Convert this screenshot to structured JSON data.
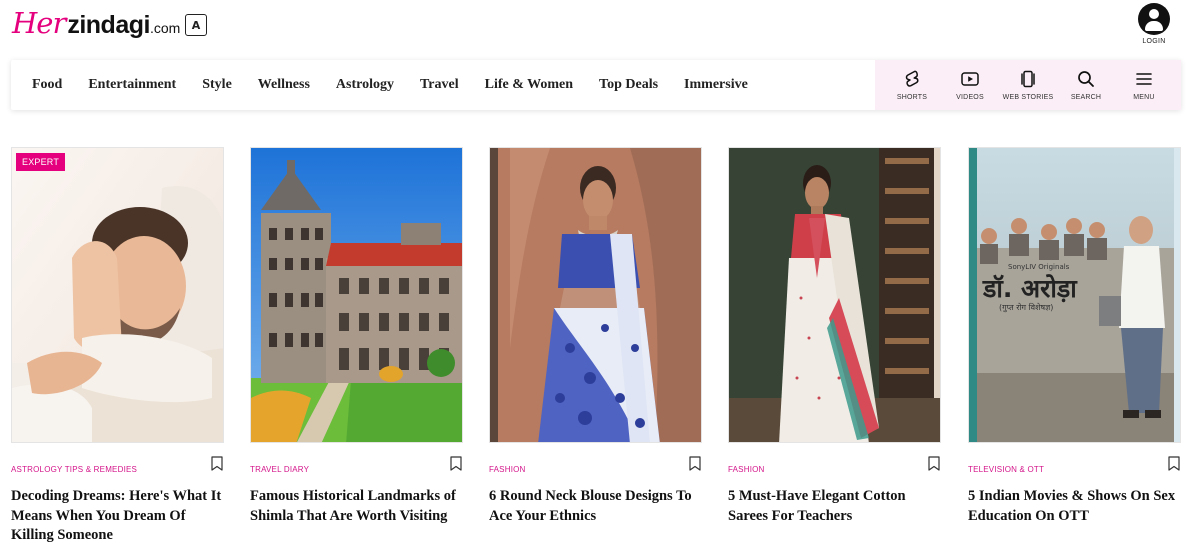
{
  "brand": {
    "logo_her": "Her",
    "logo_zindagi": "zindagi",
    "logo_com": ".com",
    "accent_color": "#e5007d"
  },
  "header": {
    "translate_icon": "translate-icon",
    "translate_glyph": "A",
    "login_label": "LOGIN"
  },
  "nav": {
    "links": [
      "Food",
      "Entertainment",
      "Style",
      "Wellness",
      "Astrology",
      "Travel",
      "Life & Women",
      "Top Deals",
      "Immersive"
    ],
    "tools": [
      {
        "label": "SHORTS",
        "icon": "shorts-icon"
      },
      {
        "label": "VIDEOS",
        "icon": "video-play-icon"
      },
      {
        "label": "WEB STORIES",
        "icon": "web-stories-icon"
      },
      {
        "label": "SEARCH",
        "icon": "search-icon"
      },
      {
        "label": "MENU",
        "icon": "hamburger-menu-icon"
      }
    ]
  },
  "articles": [
    {
      "badge": "EXPERT",
      "category": "ASTROLOGY TIPS & REMEDIES",
      "title": "Decoding Dreams: Here's What It Means When You Dream Of Killing Someone",
      "image": "man-sleeping-photo"
    },
    {
      "badge": "",
      "category": "TRAVEL DIARY",
      "title": "Famous Historical Landmarks of Shimla That Are Worth Visiting",
      "image": "shimla-heritage-building-photo"
    },
    {
      "badge": "",
      "category": "FASHION",
      "title": "6 Round Neck Blouse Designs To Ace Your Ethnics",
      "image": "woman-blue-saree-photo"
    },
    {
      "badge": "",
      "category": "FASHION",
      "title": "5 Must-Have Elegant Cotton Sarees For Teachers",
      "image": "woman-cotton-saree-photo"
    },
    {
      "badge": "",
      "category": "TELEVISION & OTT",
      "title": "5 Indian Movies & Shows On Sex Education On OTT",
      "image": "dr-arora-poster-photo",
      "poster_text": {
        "channel": "SonyLIV Originals",
        "show": "डॉ. अरोड़ा",
        "tagline": "(गुप्त रोग विशेषज्ञ)"
      }
    }
  ]
}
